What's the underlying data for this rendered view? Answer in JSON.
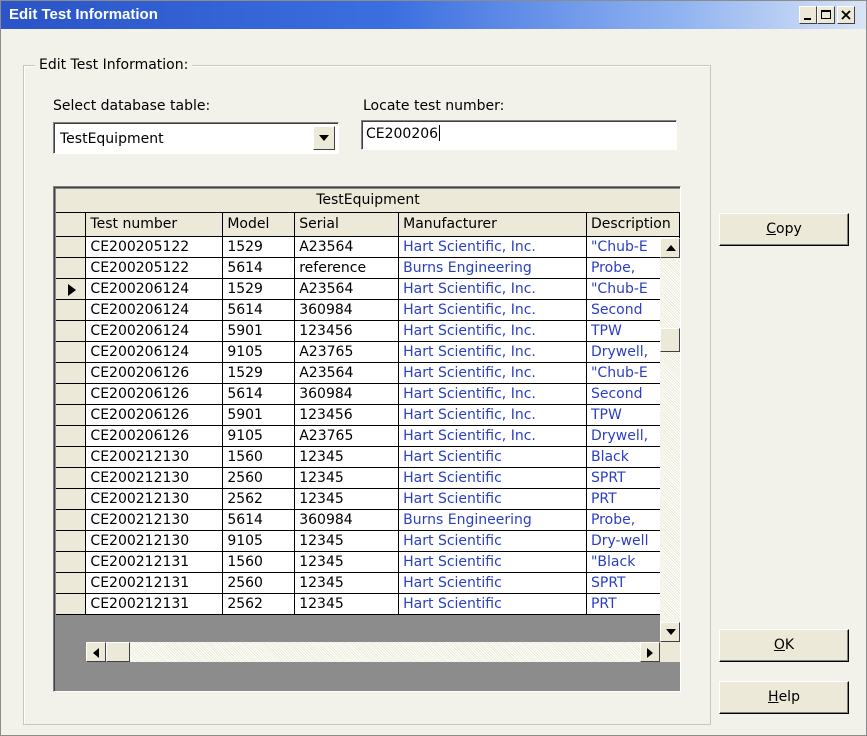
{
  "window": {
    "title": "Edit Test Information"
  },
  "titlebar_buttons": [
    "minimize-icon",
    "maximize-icon",
    "close-icon"
  ],
  "group": {
    "label": "Edit Test Information:"
  },
  "table_select": {
    "label": "Select database table:",
    "value": "TestEquipment"
  },
  "locate": {
    "label": "Locate test number:",
    "value": "CE200206"
  },
  "grid": {
    "caption": "TestEquipment",
    "columns": [
      "Test number",
      "Model",
      "Serial",
      "Manufacturer",
      "Description"
    ],
    "current_row": 2,
    "rows": [
      [
        "CE200205122",
        "1529",
        "A23564",
        "Hart Scientific, Inc.",
        "\"Chub-E"
      ],
      [
        "CE200205122",
        "5614",
        "reference",
        "Burns Engineering",
        "Probe,"
      ],
      [
        "CE200206124",
        "1529",
        "A23564",
        "Hart Scientific, Inc.",
        "\"Chub-E"
      ],
      [
        "CE200206124",
        "5614",
        "360984",
        "Hart Scientific, Inc.",
        "Second"
      ],
      [
        "CE200206124",
        "5901",
        "123456",
        "Hart Scientific, Inc.",
        "TPW"
      ],
      [
        "CE200206124",
        "9105",
        "A23765",
        "Hart Scientific, Inc.",
        "Drywell,"
      ],
      [
        "CE200206126",
        "1529",
        "A23564",
        "Hart Scientific, Inc.",
        "\"Chub-E"
      ],
      [
        "CE200206126",
        "5614",
        "360984",
        "Hart Scientific, Inc.",
        "Second"
      ],
      [
        "CE200206126",
        "5901",
        "123456",
        "Hart Scientific, Inc.",
        "TPW"
      ],
      [
        "CE200206126",
        "9105",
        "A23765",
        "Hart Scientific, Inc.",
        "Drywell,"
      ],
      [
        "CE200212130",
        "1560",
        "12345",
        "Hart Scientific",
        "Black"
      ],
      [
        "CE200212130",
        "2560",
        "12345",
        "Hart Scientific",
        "SPRT"
      ],
      [
        "CE200212130",
        "2562",
        "12345",
        "Hart Scientific",
        "PRT"
      ],
      [
        "CE200212130",
        "5614",
        "360984",
        "Burns Engineering",
        "Probe,"
      ],
      [
        "CE200212130",
        "9105",
        "12345",
        "Hart Scientific",
        "Dry-well"
      ],
      [
        "CE200212131",
        "1560",
        "12345",
        "Hart Scientific",
        "\"Black"
      ],
      [
        "CE200212131",
        "2560",
        "12345",
        "Hart Scientific",
        "SPRT"
      ],
      [
        "CE200212131",
        "2562",
        "12345",
        "Hart Scientific",
        "PRT"
      ]
    ]
  },
  "buttons": {
    "copy": {
      "mnemonic": "C",
      "rest": "opy"
    },
    "ok": {
      "mnemonic": "O",
      "rest": "K"
    },
    "help": {
      "mnemonic": "H",
      "rest": "elp"
    }
  },
  "colors": {
    "title_bar": "#2a54c8",
    "link_text": "#2a3fc2",
    "face": "#ece9d8"
  }
}
